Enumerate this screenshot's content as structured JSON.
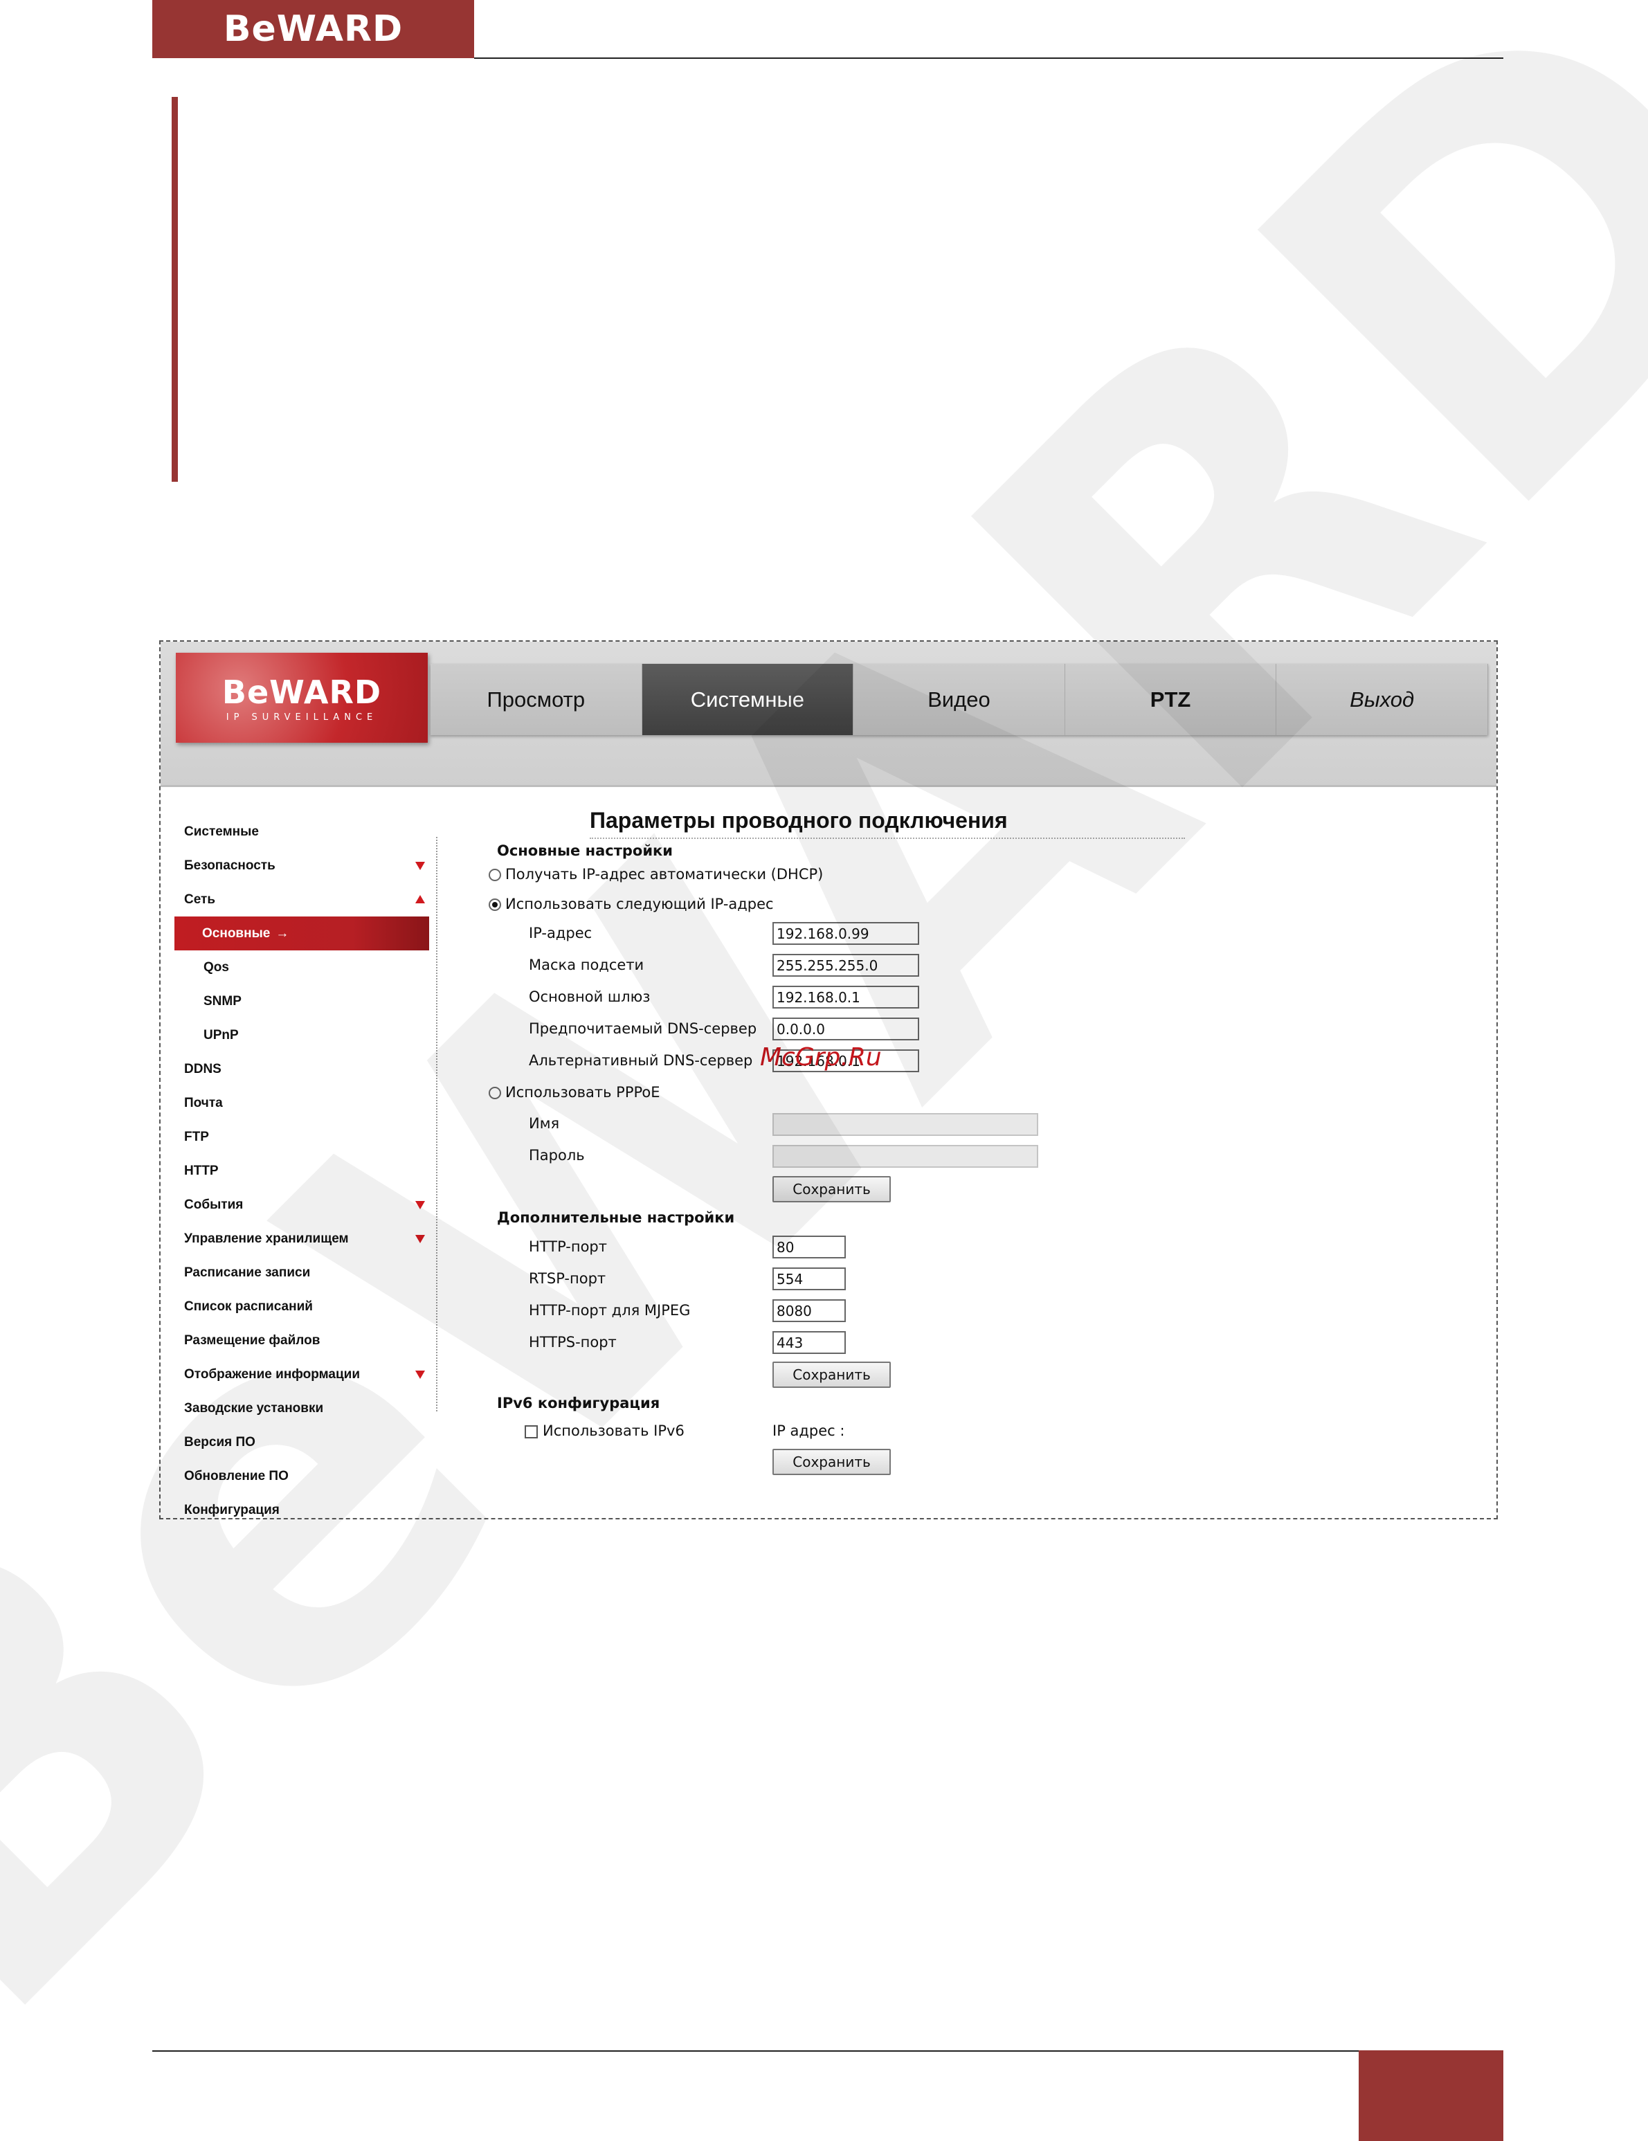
{
  "doc": {
    "logo_text": "BeWARD",
    "accent_color": "#973533",
    "watermark_text": "BeWARD"
  },
  "camera_ui": {
    "logo_text": "BeWARD",
    "logo_subtext": "IP SURVEILLANCE",
    "nav": [
      "Просмотр",
      "Системные",
      "Видео",
      "PTZ",
      "Выход"
    ],
    "active_nav": "Системные",
    "sidebar": {
      "items": [
        {
          "label": "Системные"
        },
        {
          "label": "Безопасность",
          "arrow": "down"
        },
        {
          "label": "Сеть",
          "arrow": "up"
        },
        {
          "label": "Основные",
          "sub": true,
          "active": true,
          "suffix": "→"
        },
        {
          "label": "Qos",
          "sub": true
        },
        {
          "label": "SNMP",
          "sub": true
        },
        {
          "label": "UPnP",
          "sub": true
        },
        {
          "label": "DDNS"
        },
        {
          "label": "Почта"
        },
        {
          "label": "FTP"
        },
        {
          "label": "HTTP"
        },
        {
          "label": "События",
          "arrow": "down"
        },
        {
          "label": "Управление хранилищем",
          "arrow": "down"
        },
        {
          "label": "Расписание записи"
        },
        {
          "label": "Список расписаний"
        },
        {
          "label": "Размещение файлов"
        },
        {
          "label": "Отображение информации",
          "arrow": "down"
        },
        {
          "label": "Заводские установки"
        },
        {
          "label": "Версия ПО"
        },
        {
          "label": "Обновление ПО"
        },
        {
          "label": "Конфигурация"
        }
      ]
    },
    "main": {
      "title": "Параметры проводного подключения",
      "basic": {
        "title": "Основные настройки",
        "dhcp_label": "Получать IP-адрес автоматически (DHCP)",
        "static_label": "Использовать следующий IP-адрес",
        "ip_label": "IP-адрес",
        "ip_value": "192.168.0.99",
        "mask_label": "Маска подсети",
        "mask_value": "255.255.255.0",
        "gateway_label": "Основной шлюз",
        "gateway_value": "192.168.0.1",
        "dns1_label": "Предпочитаемый DNS-сервер",
        "dns1_value": "0.0.0.0",
        "dns2_label": "Альтернативный DNS-сервер",
        "dns2_value": "192.168.0.1",
        "pppoe_label": "Использовать PPPoE",
        "name_label": "Имя",
        "password_label": "Пароль",
        "save": "Сохранить"
      },
      "advanced": {
        "title": "Дополнительные настройки",
        "http_label": "HTTP-порт",
        "http_value": "80",
        "rtsp_label": "RTSP-порт",
        "rtsp_value": "554",
        "mjpeg_label": "HTTP-порт для MJPEG",
        "mjpeg_value": "8080",
        "https_label": "HTTPS-порт",
        "https_value": "443",
        "save": "Сохранить"
      },
      "ipv6": {
        "title": "IPv6 конфигурация",
        "checkbox_label": "Использовать IPv6",
        "ip_label": "IP адрес :",
        "save": "Сохранить"
      }
    },
    "stamp": "McGrp.Ru"
  }
}
